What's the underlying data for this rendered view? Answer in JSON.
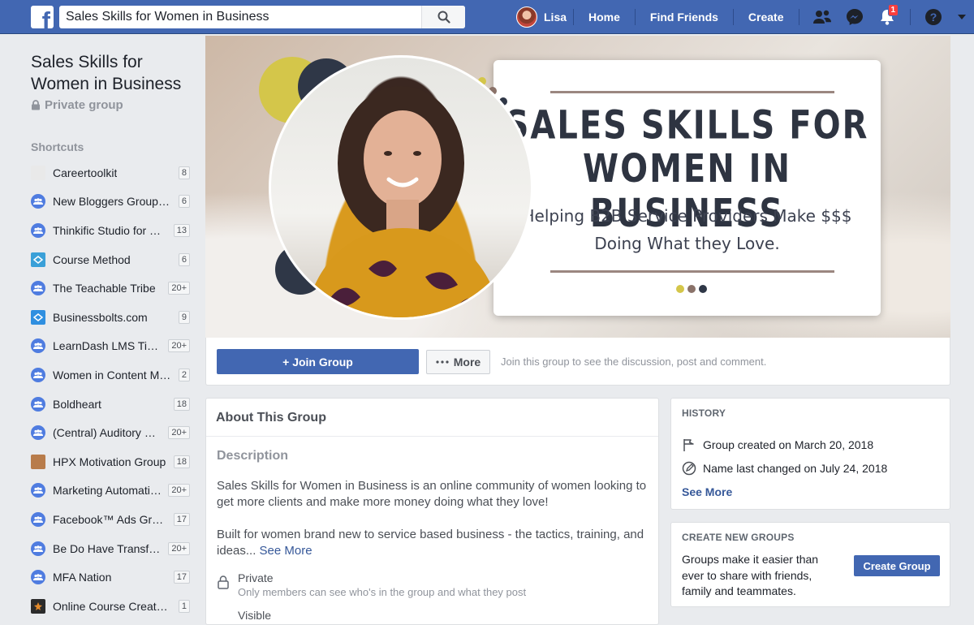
{
  "topbar": {
    "logo": "f",
    "search_value": "Sales Skills for Women in Business",
    "user_name": "Lisa",
    "nav": [
      "Home",
      "Find Friends",
      "Create"
    ],
    "notifications_count": "1",
    "brand_color": "#4267b2"
  },
  "left": {
    "group_title": "Sales Skills for Women in Business",
    "privacy": "Private group",
    "shortcuts_heading": "Shortcuts",
    "shortcuts": [
      {
        "label": "Careertoolkit",
        "count": "8",
        "icon": "thumbnail"
      },
      {
        "label": "New Bloggers Group…",
        "count": "6",
        "icon": "group-icon"
      },
      {
        "label": "Thinkific Studio for …",
        "count": "13",
        "icon": "group-icon"
      },
      {
        "label": "Course Method",
        "count": "6",
        "icon": "logo"
      },
      {
        "label": "The Teachable Tribe",
        "count": "20+",
        "icon": "group-icon"
      },
      {
        "label": "Businessbolts.com",
        "count": "9",
        "icon": "logo"
      },
      {
        "label": "LearnDash LMS Ti…",
        "count": "20+",
        "icon": "group-icon"
      },
      {
        "label": "Women in Content M…",
        "count": "2",
        "icon": "group-icon"
      },
      {
        "label": "Boldheart",
        "count": "18",
        "icon": "group-icon"
      },
      {
        "label": "(Central) Auditory …",
        "count": "20+",
        "icon": "group-icon"
      },
      {
        "label": "HPX Motivation Group",
        "count": "18",
        "icon": "thumbnail"
      },
      {
        "label": "Marketing Automati…",
        "count": "20+",
        "icon": "group-icon"
      },
      {
        "label": "Facebook™ Ads Gr…",
        "count": "17",
        "icon": "group-icon"
      },
      {
        "label": "Be Do Have Transf…",
        "count": "20+",
        "icon": "group-icon"
      },
      {
        "label": "MFA Nation",
        "count": "17",
        "icon": "group-icon"
      },
      {
        "label": "Online Course Creat…",
        "count": "1",
        "icon": "thumbnail"
      }
    ]
  },
  "cover": {
    "title_line1": "SALES SKILLS FOR",
    "title_line2": "WOMEN IN BUSINESS",
    "subtitle_line1": "Helping B2B Service Providers Make $$$",
    "subtitle_line2": "Doing What they Love.",
    "dot_colors": [
      "#d4c64a",
      "#8a7269",
      "#2f3747"
    ]
  },
  "joinbar": {
    "join_label": "+ Join Group",
    "more_label": "More",
    "note": "Join this group to see the discussion, post and comment."
  },
  "about": {
    "heading": "About This Group",
    "description_heading": "Description",
    "para1": "Sales Skills for Women in Business is an online community of women looking to get more clients and make more money doing what they love!",
    "para2": "Built for women brand new to service based business - the tactics, training, and ideas...",
    "see_more": "See More",
    "private_title": "Private",
    "private_sub": "Only members can see who's in the group and what they post",
    "visible_title": "Visible"
  },
  "history": {
    "heading": "HISTORY",
    "created": "Group created on March 20, 2018",
    "name_changed": "Name last changed on July 24, 2018",
    "see_more": "See More"
  },
  "create_groups": {
    "heading": "CREATE NEW GROUPS",
    "text": "Groups make it easier than ever to share with friends, family and teammates.",
    "button": "Create Group"
  }
}
